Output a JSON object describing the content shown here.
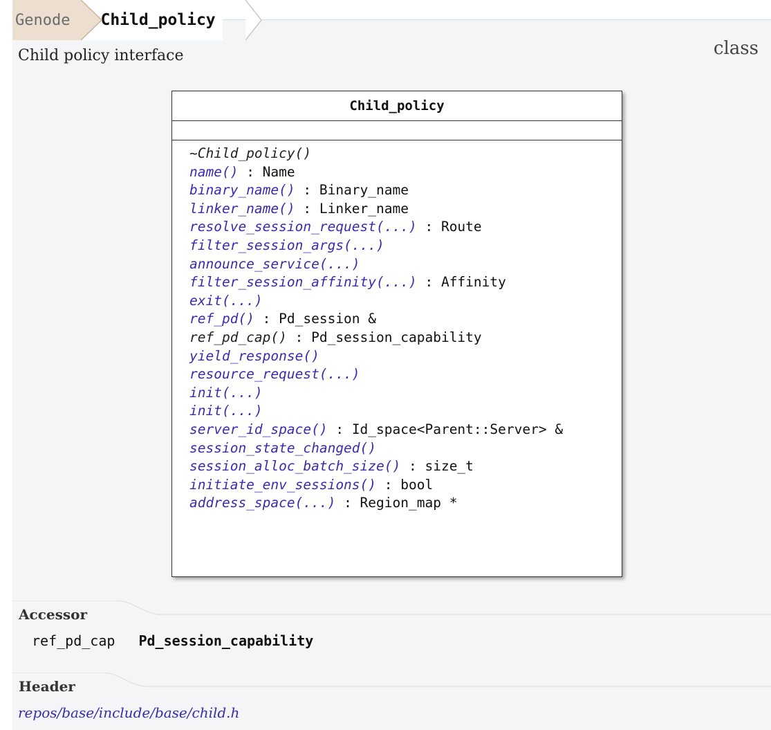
{
  "breadcrumb": {
    "parent": "Genode",
    "current": "Child_policy"
  },
  "brief": "Child policy interface",
  "kind": "class",
  "uml": {
    "class_name": "Child_policy",
    "methods": [
      {
        "name": "~Child_policy()",
        "ret": "",
        "link": false
      },
      {
        "name": "name()",
        "ret": " : Name",
        "link": true
      },
      {
        "name": "binary_name()",
        "ret": " : Binary_name",
        "link": true
      },
      {
        "name": "linker_name()",
        "ret": " : Linker_name",
        "link": true
      },
      {
        "name": "resolve_session_request(...)",
        "ret": " : Route",
        "link": true
      },
      {
        "name": "filter_session_args(...)",
        "ret": "",
        "link": true
      },
      {
        "name": "announce_service(...)",
        "ret": "",
        "link": true
      },
      {
        "name": "filter_session_affinity(...)",
        "ret": " : Affinity",
        "link": true
      },
      {
        "name": "exit(...)",
        "ret": "",
        "link": true
      },
      {
        "name": "ref_pd()",
        "ret": " : Pd_session &",
        "link": true
      },
      {
        "name": "ref_pd_cap()",
        "ret": " : Pd_session_capability",
        "link": false
      },
      {
        "name": "yield_response()",
        "ret": "",
        "link": true
      },
      {
        "name": "resource_request(...)",
        "ret": "",
        "link": true
      },
      {
        "name": "init(...)",
        "ret": "",
        "link": true
      },
      {
        "name": "init(...)",
        "ret": "",
        "link": true
      },
      {
        "name": "server_id_space()",
        "ret": " : Id_space<Parent::Server> &",
        "link": true
      },
      {
        "name": "session_state_changed()",
        "ret": "",
        "link": true
      },
      {
        "name": "session_alloc_batch_size()",
        "ret": " : size_t",
        "link": true
      },
      {
        "name": "initiate_env_sessions()",
        "ret": " : bool",
        "link": true
      },
      {
        "name": "address_space(...)",
        "ret": " : Region_map *",
        "link": true
      }
    ]
  },
  "accessor": {
    "heading": "Accessor",
    "name": "ref_pd_cap",
    "type": "Pd_session_capability"
  },
  "header": {
    "heading": "Header",
    "path": "repos/base/include/base/child.h"
  },
  "colors": {
    "link": "#3a2bb3",
    "panel": "#f3f5f6",
    "crumb_parent_bg": "#ecdfd0"
  }
}
